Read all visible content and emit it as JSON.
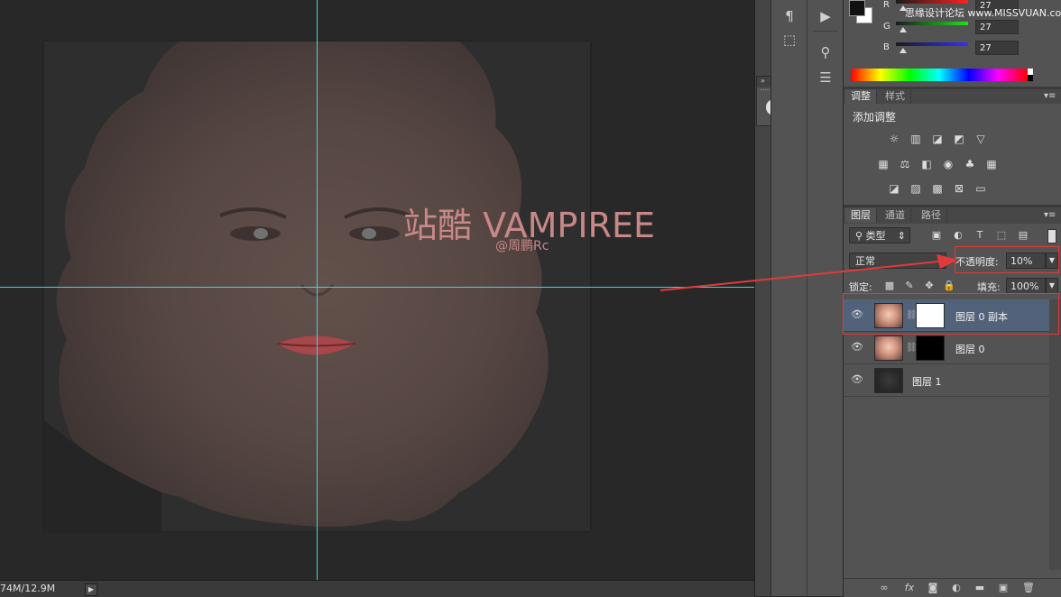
{
  "watermark": {
    "title": "站酷 VAMPIREE",
    "subtitle": "@周鹏Rc"
  },
  "status_bar": {
    "doc_size": "74M/12.9M"
  },
  "color_panel": {
    "channels": [
      {
        "label": "R",
        "value": "27"
      },
      {
        "label": "G",
        "value": "27"
      },
      {
        "label": "B",
        "value": "27"
      }
    ],
    "site_watermark": "思缘设计论坛 www.MISSVUAN.com"
  },
  "adjust_panel": {
    "tabs": [
      {
        "label": "调整"
      },
      {
        "label": "样式"
      }
    ],
    "heading": "添加调整"
  },
  "layers_panel": {
    "tabs": [
      {
        "label": "图层"
      },
      {
        "label": "通道"
      },
      {
        "label": "路径"
      }
    ],
    "filter_kind": "类型",
    "blend_mode": "正常",
    "opacity_label": "不透明度:",
    "opacity_value": "10%",
    "lock_label": "锁定:",
    "fill_label": "填充:",
    "fill_value": "100%",
    "layers": [
      {
        "name": "图层 0 副本"
      },
      {
        "name": "图层 0"
      },
      {
        "name": "图层 1"
      }
    ]
  },
  "colors": {
    "guide": "#3fd6de",
    "selection": "#52627a",
    "annotation": "#e03a3a",
    "watermark_text": "#c88888"
  }
}
